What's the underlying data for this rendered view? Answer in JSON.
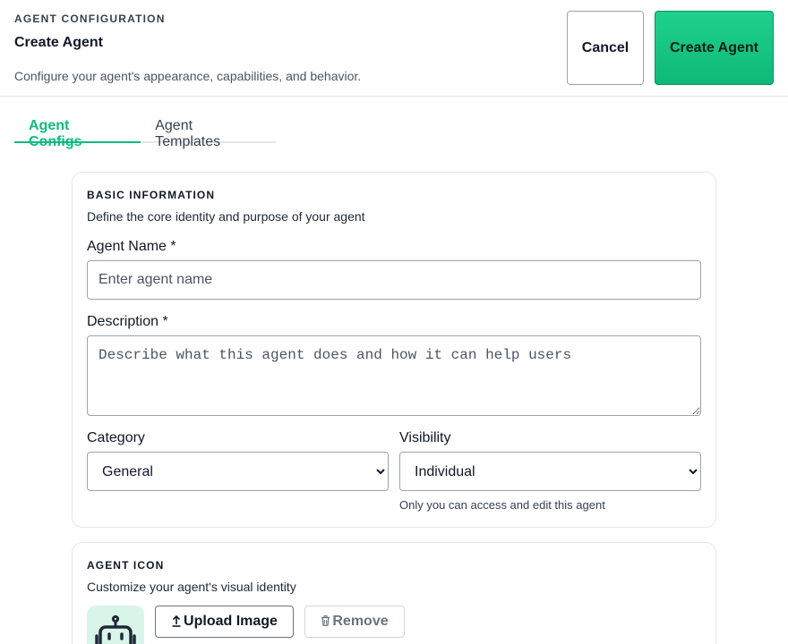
{
  "header": {
    "eyebrow": "AGENT CONFIGURATION",
    "title": "Create Agent",
    "subtitle": "Configure your agent's appearance, capabilities, and behavior.",
    "cancel_label": "Cancel",
    "create_label": "Create Agent"
  },
  "tabs": [
    {
      "label": "Agent Configs",
      "active": true
    },
    {
      "label": "Agent Templates",
      "active": false
    }
  ],
  "basic_info": {
    "title": "BASIC INFORMATION",
    "description": "Define the core identity and purpose of your agent",
    "name_label": "Agent Name *",
    "name_placeholder": "Enter agent name",
    "description_label": "Description *",
    "description_placeholder": "Describe what this agent does and how it can help users",
    "category_label": "Category",
    "category_value": "General",
    "visibility_label": "Visibility",
    "visibility_value": "Individual",
    "visibility_helper": "Only you can access and edit this agent"
  },
  "agent_icon": {
    "title": "AGENT ICON",
    "description": "Customize your agent's visual identity",
    "upload_label": "Upload Image",
    "remove_label": "Remove",
    "preview_icon": "robot-icon",
    "upload_icon": "upload-icon",
    "remove_icon": "trash-icon"
  },
  "colors": {
    "accent": "#10b981",
    "primary_button": "#1fd18d",
    "icon_bg": "#d9f5e9",
    "icon_fg": "#1f2937"
  }
}
